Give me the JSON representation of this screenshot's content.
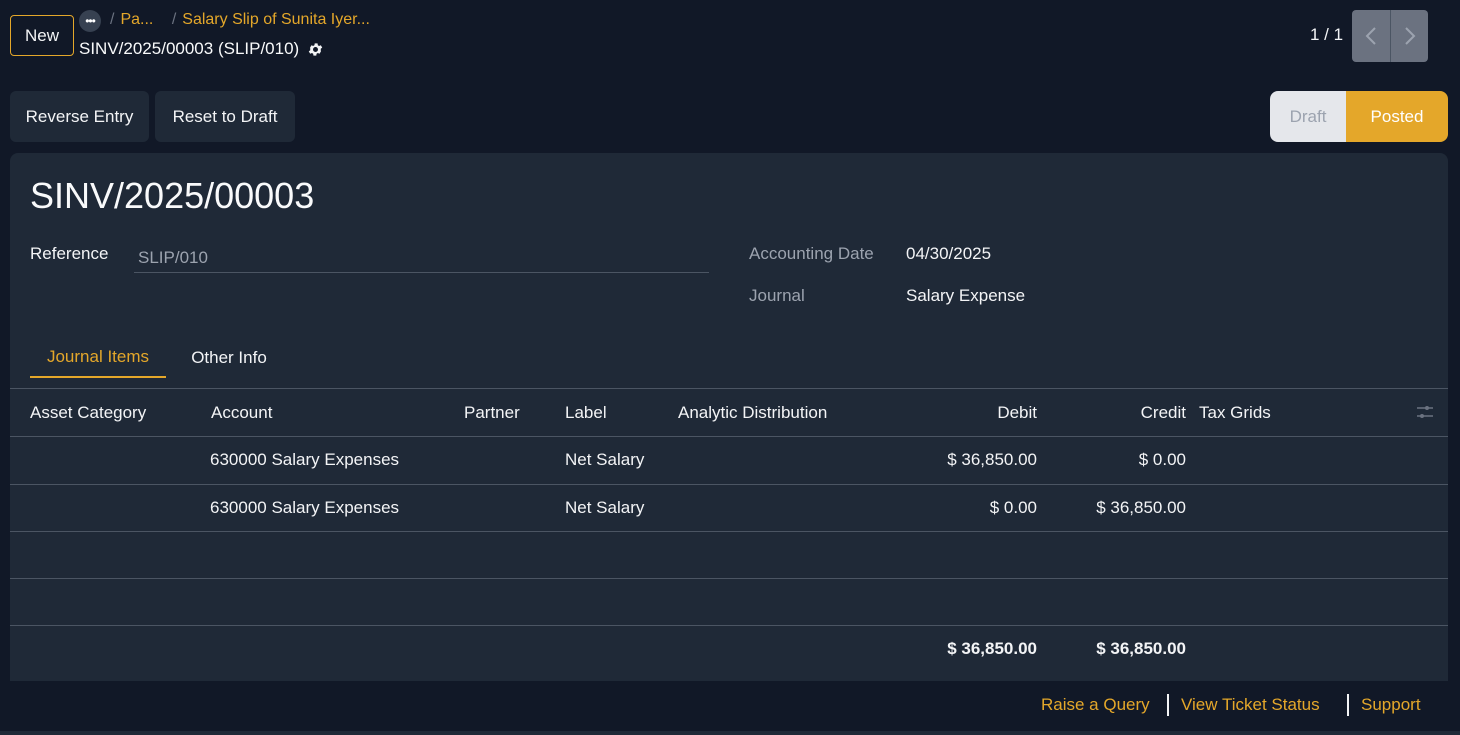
{
  "header": {
    "new_label": "New",
    "more_label": "•••",
    "breadcrumb_parent": "Pa...",
    "breadcrumb_slip": "Salary Slip of Sunita Iyer...",
    "breadcrumb_sep": "/",
    "record_name": "SINV/2025/00003 (SLIP/010)",
    "pager": "1 / 1"
  },
  "actions": {
    "reverse_entry": "Reverse Entry",
    "reset_to_draft": "Reset to Draft"
  },
  "status": {
    "draft": "Draft",
    "posted": "Posted",
    "current": "Posted"
  },
  "form": {
    "title": "SINV/2025/00003",
    "reference_label": "Reference",
    "reference_placeholder": "SLIP/010",
    "accounting_date_label": "Accounting Date",
    "accounting_date": "04/30/2025",
    "journal_label": "Journal",
    "journal": "Salary Expense"
  },
  "tabs": [
    {
      "label": "Journal Items",
      "active": true
    },
    {
      "label": "Other Info",
      "active": false
    }
  ],
  "table": {
    "columns": [
      "Asset Category",
      "Account",
      "Partner",
      "Label",
      "Analytic Distribution",
      "Debit",
      "Credit",
      "Tax Grids"
    ],
    "rows": [
      {
        "asset_category": "",
        "account": "630000 Salary Expenses",
        "partner": "",
        "label": "Net Salary",
        "analytic": "",
        "debit": "$ 36,850.00",
        "credit": "$ 0.00",
        "tax_grids": ""
      },
      {
        "asset_category": "",
        "account": "630000 Salary Expenses",
        "partner": "",
        "label": "Net Salary",
        "analytic": "",
        "debit": "$ 0.00",
        "credit": "$ 36,850.00",
        "tax_grids": ""
      }
    ],
    "total_debit": "$ 36,850.00",
    "total_credit": "$ 36,850.00"
  },
  "footer": {
    "raise_query": "Raise a Query",
    "view_ticket_status": "View Ticket Status",
    "support": "Support"
  },
  "colors": {
    "accent": "#e4a72a",
    "background": "#111827",
    "sheet": "#1f2937"
  }
}
